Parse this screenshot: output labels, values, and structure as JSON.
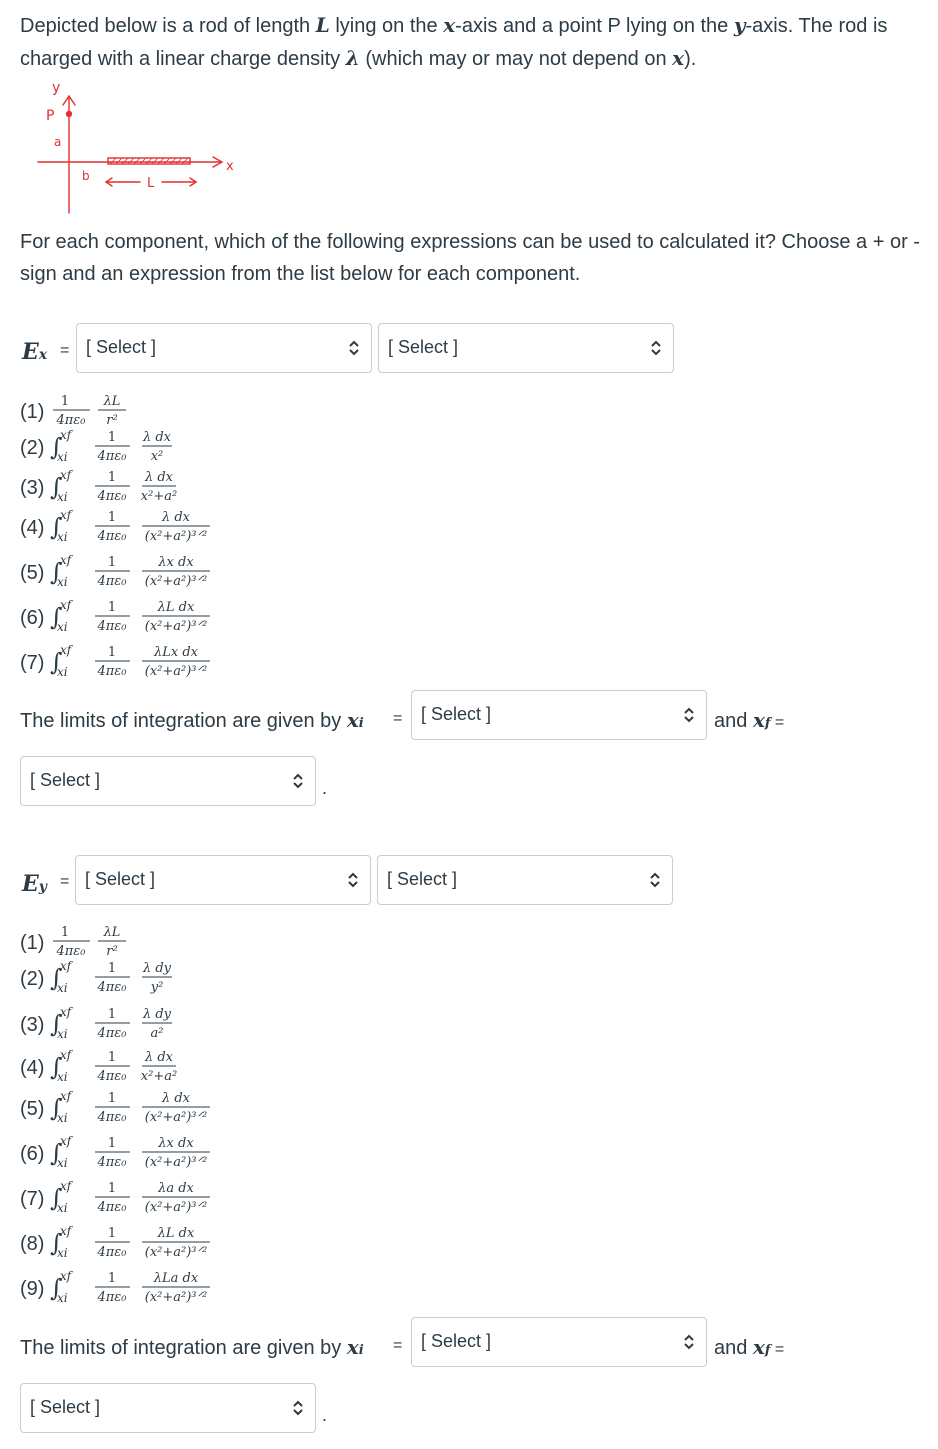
{
  "intro": {
    "p1_a": "Depicted below is a rod of length ",
    "L": "L",
    "p1_b": " lying on the ",
    "x": "x",
    "p1_c": "-axis and a point P lying on the ",
    "y": "y",
    "p1_d": "-axis.  The rod is charged with a linear charge density ",
    "lambda": "λ",
    "p1_e": " (which may or may not depend on ",
    "p1_f": ")."
  },
  "diagram": {
    "y_label": "y",
    "p_label": "P",
    "a_label": "a",
    "b_label": "b",
    "l_label": "L",
    "x_label": "x",
    "color": "#e03030"
  },
  "question": "For each component, which of the following expressions can be used to calculated it?  Choose a + or - sign and an expression from the list below for each component.",
  "select_placeholder": "[ Select ]",
  "ex": {
    "label": "E",
    "sub": "x",
    "eq": "=",
    "options": [
      "(1)",
      "(2)",
      "(3)",
      "(4)",
      "(5)",
      "(6)",
      "(7)"
    ],
    "limits_text": "The limits of integration are given by ",
    "xi": "x",
    "i": "i",
    "and": "and ",
    "f": "f",
    "period": "."
  },
  "ey": {
    "label": "E",
    "sub": "y",
    "eq": "=",
    "options": [
      "(1)",
      "(2)",
      "(3)",
      "(4)",
      "(5)",
      "(6)",
      "(7)",
      "(8)",
      "(9)"
    ],
    "limits_text": "The limits of integration are given by ",
    "and": "and ",
    "period": "."
  },
  "math": {
    "one": "1",
    "four_pi_eps": "4πε₀",
    "lambda_L": "λL",
    "r2": "r²",
    "ex_numerators": [
      "λ dx",
      "λ dx",
      "λ dx",
      "λx dx",
      "λL dx",
      "λLx dx"
    ],
    "ex_denominators": [
      "x²",
      "x²+a²",
      "(x²+a²)³ᐟ²",
      "(x²+a²)³ᐟ²",
      "(x²+a²)³ᐟ²",
      "(x²+a²)³ᐟ²"
    ],
    "ey_numerators": [
      "λ dy",
      "λ dy",
      "λ dx",
      "λ dx",
      "λx dx",
      "λa dx",
      "λL dx",
      "λLa dx"
    ],
    "ey_denominators": [
      "y²",
      "a²",
      "x²+a²",
      "(x²+a²)³ᐟ²",
      "(x²+a²)³ᐟ²",
      "(x²+a²)³ᐟ²",
      "(x²+a²)³ᐟ²",
      "(x²+a²)³ᐟ²"
    ],
    "integral": "∫",
    "upper": "x",
    "upper_sub": "f",
    "lower": "x",
    "lower_sub": "i"
  }
}
